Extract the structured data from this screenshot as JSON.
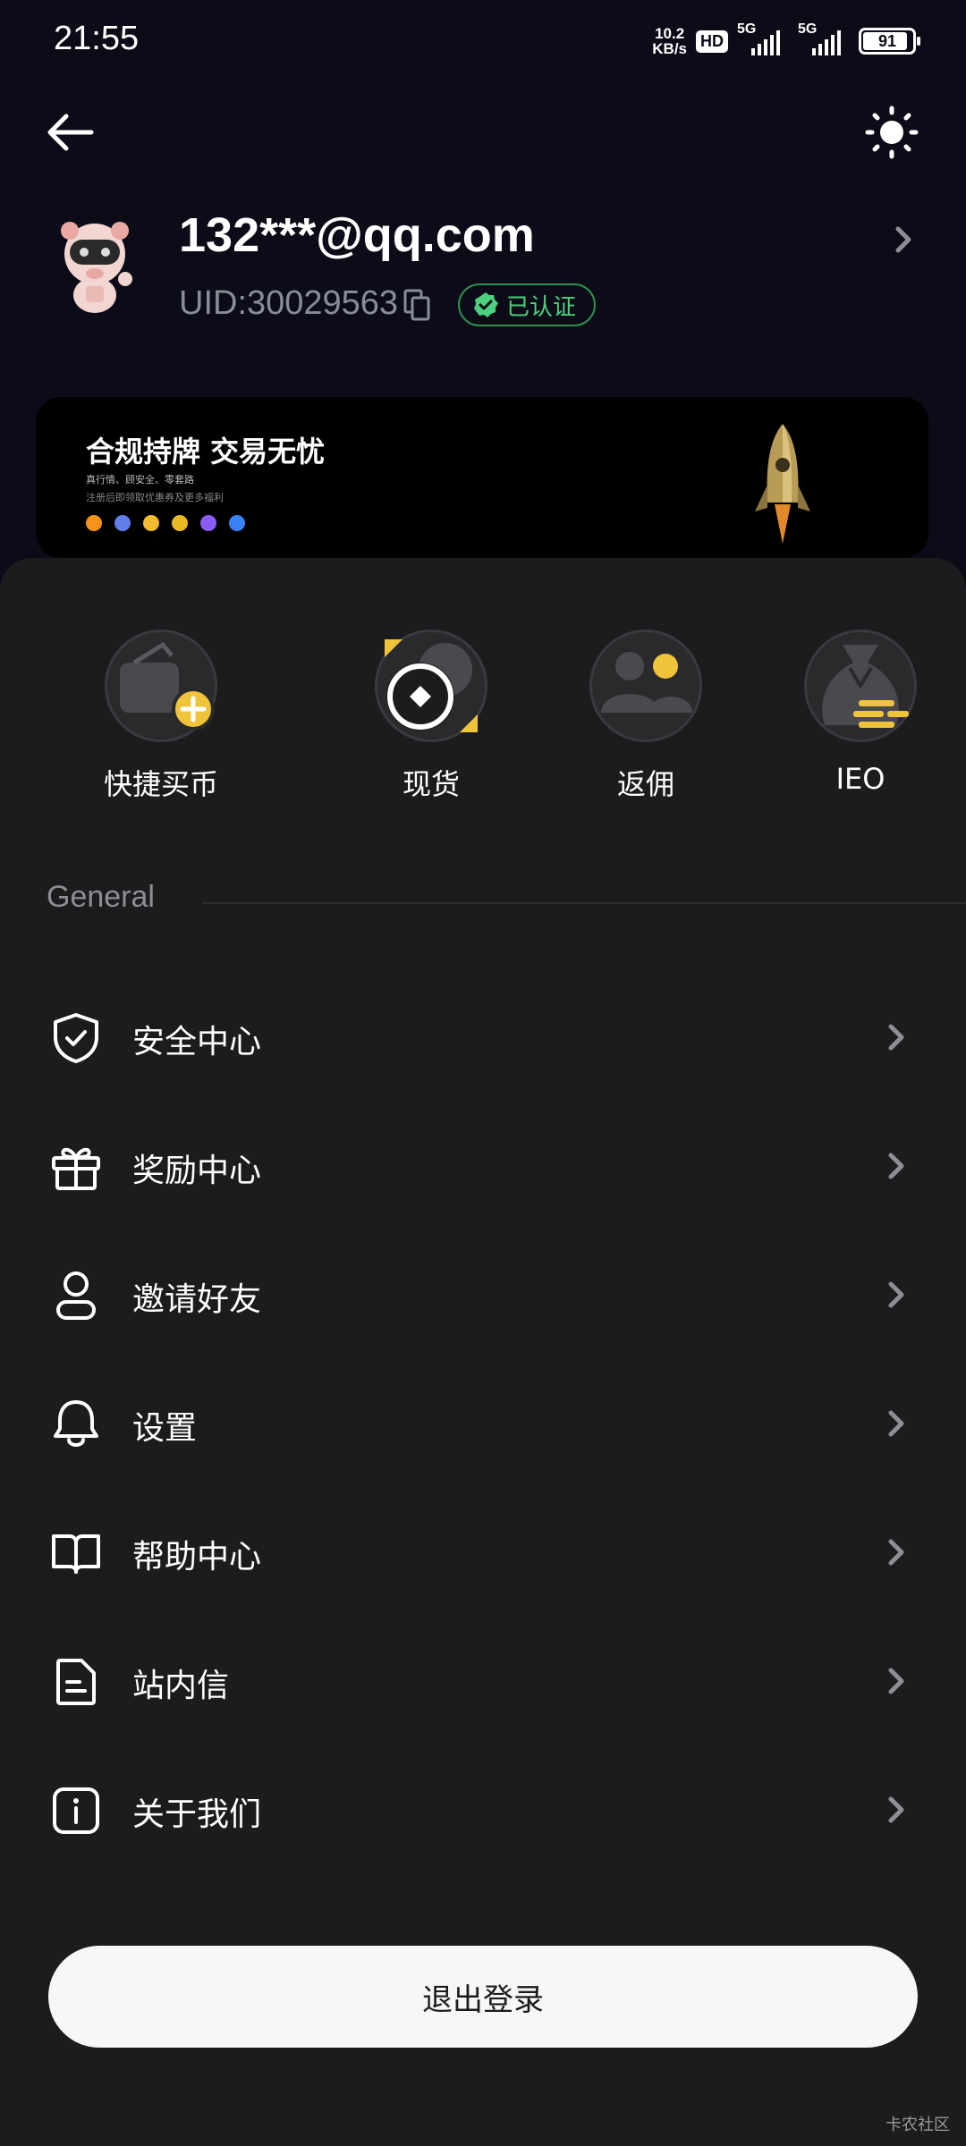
{
  "status_bar": {
    "time": "21:55",
    "net_speed_value": "10.2",
    "net_speed_unit": "KB/s",
    "hd_label": "HD",
    "signal1_label": "5G",
    "signal2_label": "5G",
    "battery": "91"
  },
  "profile": {
    "email": "132***@qq.com",
    "uid": "UID:30029563",
    "verified_label": "已认证"
  },
  "banner": {
    "title": "合规持牌 交易无忧",
    "subtitle1": "真行情、顾安全、零套路",
    "subtitle2": "注册后即领取优惠券及更多福利",
    "coin_colors": [
      "#f7931a",
      "#627eea",
      "#f3ba2f",
      "#e8b923",
      "#8a5cf6",
      "#3b82f6"
    ]
  },
  "quick_actions": [
    {
      "label": "快捷买币",
      "icon": "wallet-add-icon"
    },
    {
      "label": "现货",
      "icon": "spot-coin-icon"
    },
    {
      "label": "返佣",
      "icon": "rebate-users-icon"
    },
    {
      "label": "IEO",
      "icon": "money-bag-icon"
    }
  ],
  "section": {
    "title": "General"
  },
  "menu": [
    {
      "label": "安全中心",
      "icon": "shield-check-icon"
    },
    {
      "label": "奖励中心",
      "icon": "gift-icon"
    },
    {
      "label": "邀请好友",
      "icon": "user-icon"
    },
    {
      "label": "设置",
      "icon": "bell-icon"
    },
    {
      "label": "帮助中心",
      "icon": "book-icon"
    },
    {
      "label": "站内信",
      "icon": "document-icon"
    },
    {
      "label": "关于我们",
      "icon": "info-icon"
    }
  ],
  "logout_label": "退出登录",
  "watermark": "卡农社区",
  "colors": {
    "accent_yellow": "#f0c43a",
    "verified_green": "#4cd07d",
    "background": "#1c1c1e",
    "header_background": "#0b0c18"
  }
}
